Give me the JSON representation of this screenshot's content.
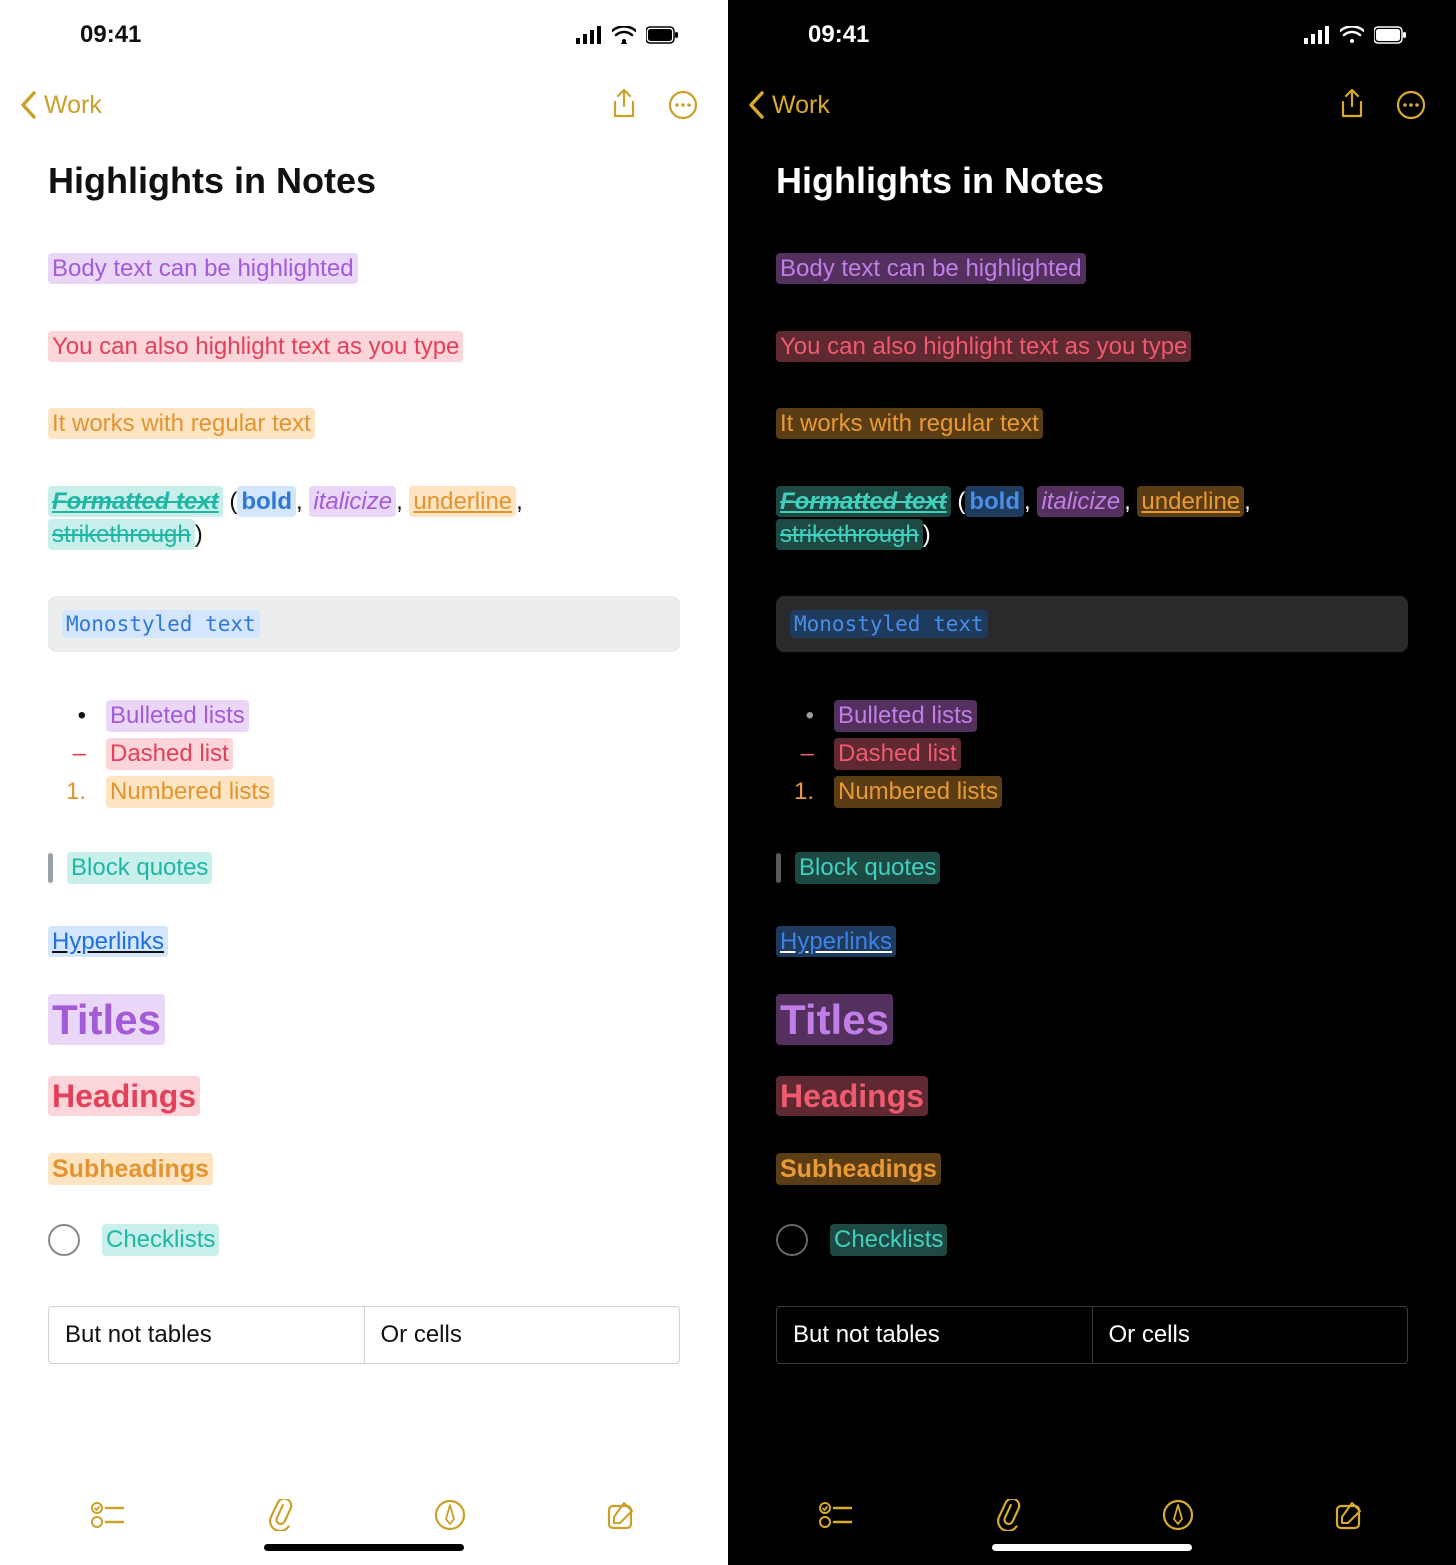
{
  "status": {
    "time": "09:41"
  },
  "nav": {
    "back_label": "Work"
  },
  "note": {
    "title": "Highlights in Notes",
    "body1": "Body text can be highlighted",
    "body2": "You can also highlight text as you type",
    "body3": "It works with regular text",
    "fmt": {
      "lead": "Formatted text",
      "open": " (",
      "bold": "bold",
      "c1": ", ",
      "ital": "italicize",
      "c2": ", ",
      "under": "underline",
      "c3": ", ",
      "strike": "strikethrough",
      "close": ")"
    },
    "mono": "Monostyled text",
    "lists": {
      "bullet": "Bulleted lists",
      "dash": "Dashed list",
      "number": "Numbered lists",
      "dash_marker": "–",
      "num_marker": "1.",
      "bullet_marker": "•"
    },
    "blockquote": "Block quotes",
    "hyperlink": "Hyperlinks",
    "h1": "Titles",
    "h2": "Headings",
    "h3": "Subheadings",
    "checklist": "Checklists",
    "table": {
      "c1": "But not tables",
      "c2": "Or cells"
    }
  },
  "colors": {
    "accent_light": "#c9a12a",
    "accent_dark": "#d8aa2d",
    "light": {
      "purple_bg": "#ead6f6",
      "purple_fg": "#a35bd8",
      "pink_bg": "#fbd5da",
      "pink_fg": "#e3405a",
      "orange_bg": "#fde5c4",
      "orange_fg": "#e3942e",
      "mint_bg": "#c9efea",
      "mint_fg": "#1eb7a6",
      "blue_bg": "#d3e6fb",
      "blue_fg": "#2f77d8",
      "gray_bg": "#e3e4e6",
      "gray_fg": "#6e7176",
      "link": "#1f6fe0"
    },
    "dark": {
      "purple_bg": "#54305f",
      "purple_fg": "#c17ee6",
      "pink_bg": "#5e2930",
      "pink_fg": "#f05a70",
      "orange_bg": "#5a3c15",
      "orange_fg": "#e99a33",
      "mint_bg": "#1e4943",
      "mint_fg": "#3fd0bf",
      "blue_bg": "#1e3a5c",
      "blue_fg": "#4a8de8",
      "gray_bg": "#3a3c3f",
      "gray_fg": "#9ea2a8",
      "link": "#3e82e6"
    }
  }
}
